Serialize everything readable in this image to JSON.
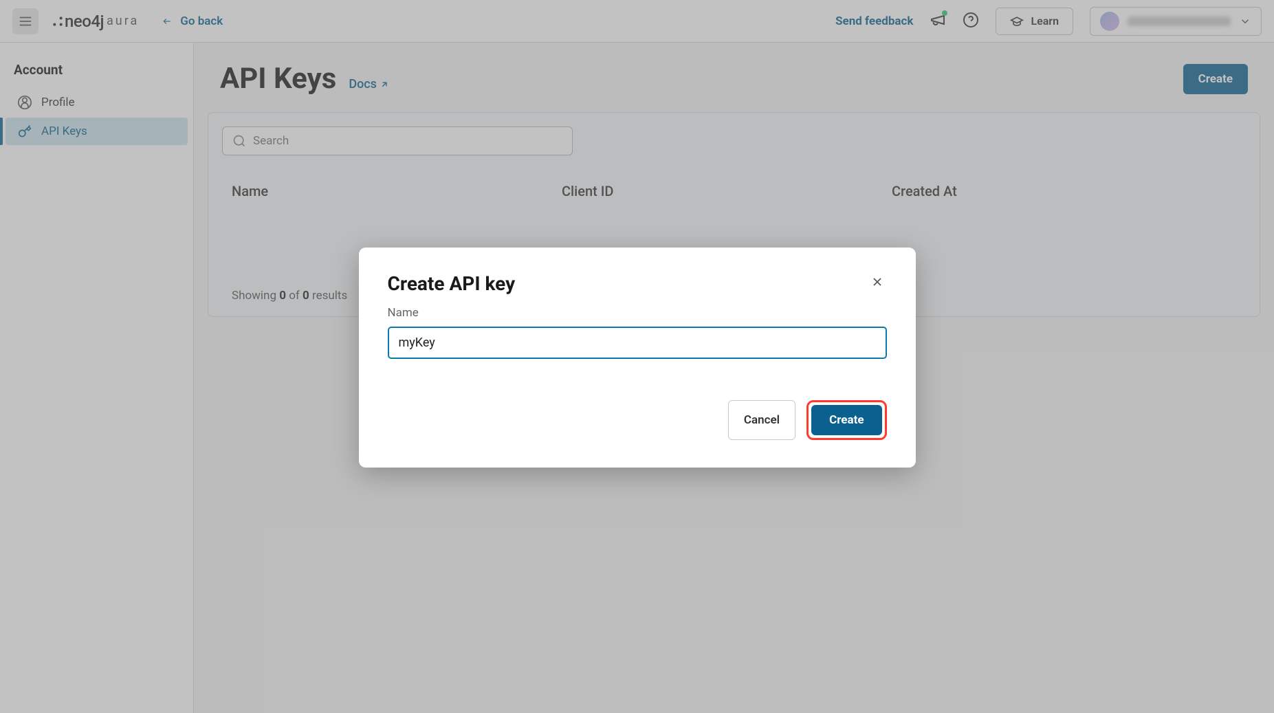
{
  "header": {
    "logo_brand": "neo4j",
    "logo_product": "aura",
    "go_back": "Go back",
    "feedback": "Send feedback",
    "learn": "Learn"
  },
  "sidebar": {
    "title": "Account",
    "items": [
      {
        "label": "Profile",
        "active": false
      },
      {
        "label": "API Keys",
        "active": true
      }
    ]
  },
  "page": {
    "title": "API Keys",
    "docs": "Docs",
    "create": "Create",
    "search_placeholder": "Search",
    "columns": {
      "name": "Name",
      "client_id": "Client ID",
      "created_at": "Created At"
    },
    "footer": {
      "prefix": "Showing ",
      "shown": "0",
      "of": " of ",
      "total": "0",
      "suffix": " results"
    }
  },
  "modal": {
    "title": "Create API key",
    "name_label": "Name",
    "name_value": "myKey",
    "cancel": "Cancel",
    "create": "Create"
  }
}
